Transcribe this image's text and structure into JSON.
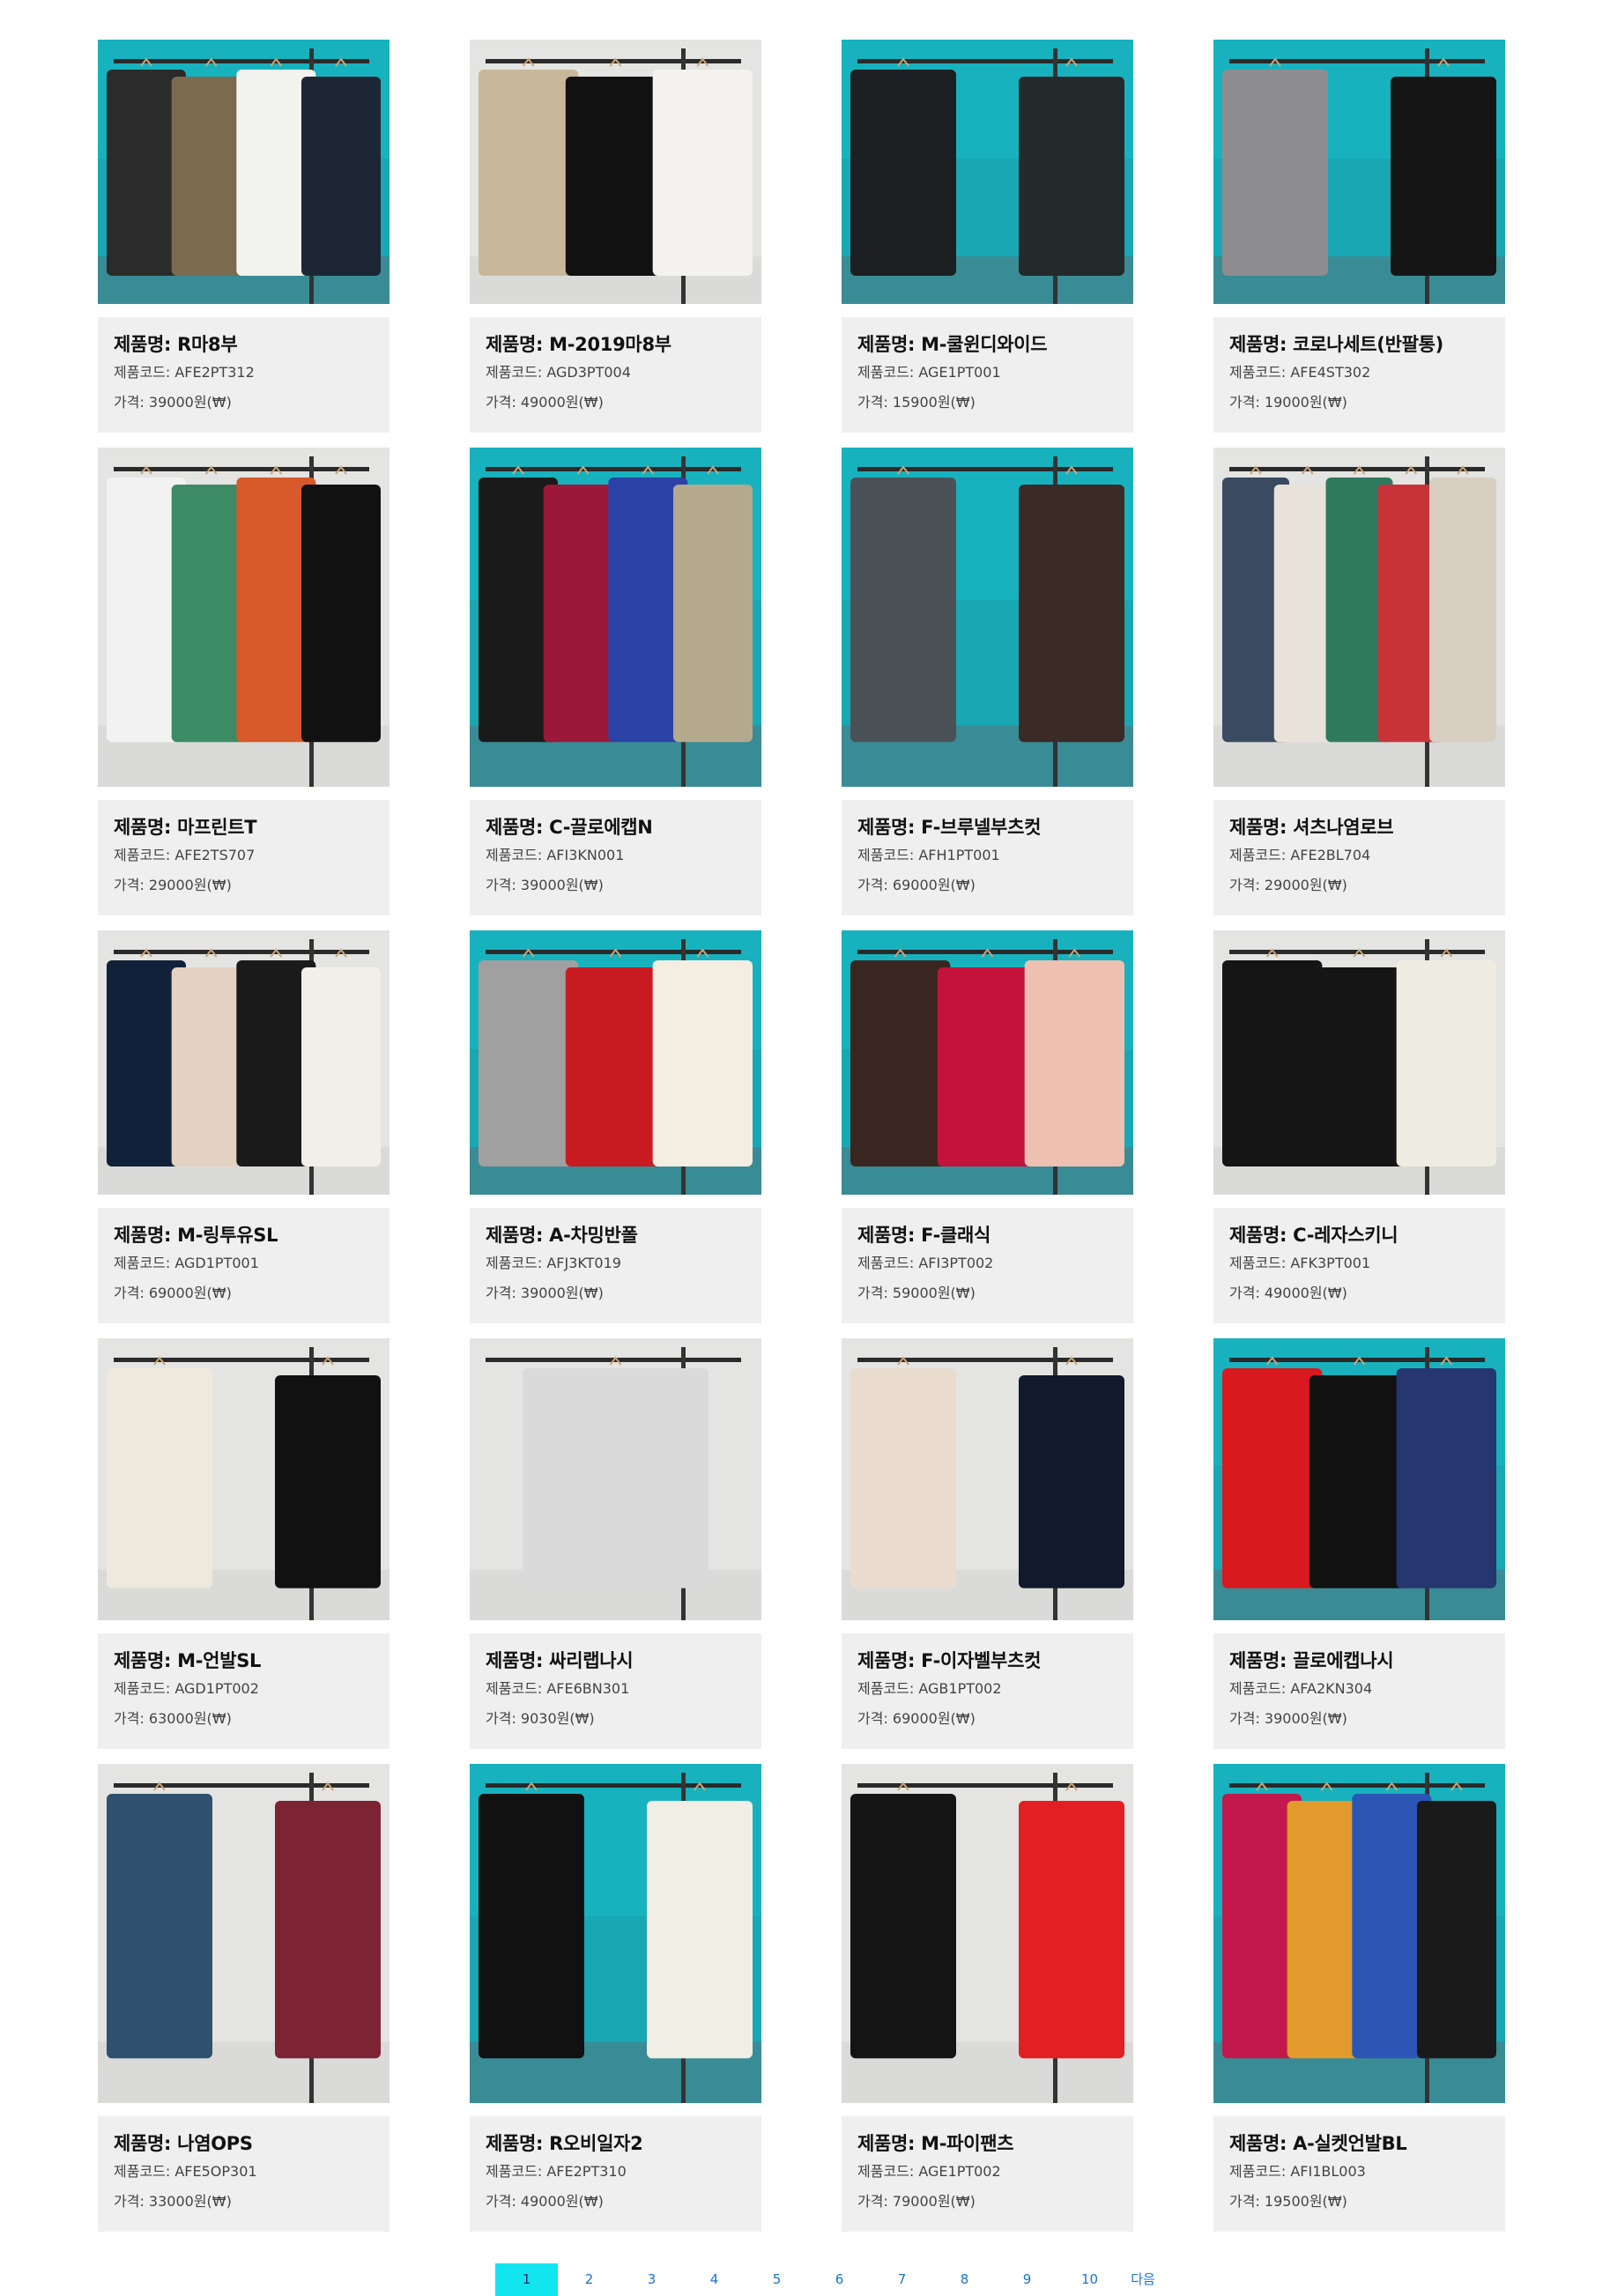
{
  "labels": {
    "name_prefix": "제품명: ",
    "code_prefix": "제품코드: ",
    "price_prefix": "가격: ",
    "currency_suffix": "원(₩)"
  },
  "products": [
    {
      "name": "R마8부",
      "code": "AFE2PT312",
      "price": "39000",
      "bg": "teal"
    },
    {
      "name": "M-2019마8부",
      "code": "AGD3PT004",
      "price": "49000",
      "bg": "white"
    },
    {
      "name": "M-쿨윈디와이드",
      "code": "AGE1PT001",
      "price": "15900",
      "bg": "teal"
    },
    {
      "name": "코로나세트(반팔통)",
      "code": "AFE4ST302",
      "price": "19000",
      "bg": "teal"
    },
    {
      "name": "마프린트T",
      "code": "AFE2TS707",
      "price": "29000",
      "bg": "white"
    },
    {
      "name": "C-끌로에캡N",
      "code": "AFI3KN001",
      "price": "39000",
      "bg": "teal"
    },
    {
      "name": "F-브루넬부츠컷",
      "code": "AFH1PT001",
      "price": "69000",
      "bg": "teal"
    },
    {
      "name": "셔츠나염로브",
      "code": "AFE2BL704",
      "price": "29000",
      "bg": "white"
    },
    {
      "name": "M-링투유SL",
      "code": "AGD1PT001",
      "price": "69000",
      "bg": "white"
    },
    {
      "name": "A-차밍반폴",
      "code": "AFJ3KT019",
      "price": "39000",
      "bg": "teal"
    },
    {
      "name": "F-클래식",
      "code": "AFI3PT002",
      "price": "59000",
      "bg": "teal"
    },
    {
      "name": "C-레자스키니",
      "code": "AFK3PT001",
      "price": "49000",
      "bg": "white"
    },
    {
      "name": "M-언발SL",
      "code": "AGD1PT002",
      "price": "63000",
      "bg": "white"
    },
    {
      "name": "싸리랩나시",
      "code": "AFE6BN301",
      "price": "9030",
      "bg": "white"
    },
    {
      "name": "F-이자벨부츠컷",
      "code": "AGB1PT002",
      "price": "69000",
      "bg": "white"
    },
    {
      "name": "끌로에캡나시",
      "code": "AFA2KN304",
      "price": "39000",
      "bg": "teal"
    },
    {
      "name": "나염OPS",
      "code": "AFE5OP301",
      "price": "33000",
      "bg": "white"
    },
    {
      "name": "R오비일자2",
      "code": "AFE2PT310",
      "price": "49000",
      "bg": "teal"
    },
    {
      "name": "M-파이팬츠",
      "code": "AGE1PT002",
      "price": "79000",
      "bg": "white"
    },
    {
      "name": "A-실켓언발BL",
      "code": "AFI1BL003",
      "price": "19500",
      "bg": "teal"
    }
  ],
  "row_photo_heights": [
    300,
    385,
    300,
    320,
    385
  ],
  "garment_colors": [
    [
      "#2b2b2b",
      "#7a6b4f",
      "#f2f2ee",
      "#1d2635"
    ],
    [
      "#c9b79a",
      "#111111",
      "#f3f2ee"
    ],
    [
      "#1c1f22",
      "#24292c"
    ],
    [
      "#8d8d8f",
      "#151515"
    ],
    [
      "#f2f2f2",
      "#3c8b64",
      "#d85a2a",
      "#111111"
    ],
    [
      "#1a1a1a",
      "#9b1838",
      "#2b43a8",
      "#b5a98d"
    ],
    [
      "#4a5258",
      "#3a2b27"
    ],
    [
      "#3a4a60",
      "#e8e3da",
      "#2f7a5f",
      "#c73339",
      "#d8cfc2"
    ],
    [
      "#12213a",
      "#e3d1c2",
      "#1a1a1a",
      "#f1efe8"
    ],
    [
      "#a0a0a0",
      "#c81c22",
      "#f3ede2"
    ],
    [
      "#3a2621",
      "#c3123c",
      "#edc0b2"
    ],
    [
      "#151515",
      "#151515",
      "#efece2"
    ],
    [
      "#efe9dd",
      "#111111"
    ],
    [
      "#dadada"
    ],
    [
      "#eadbcf",
      "#111a2c"
    ],
    [
      "#d8191f",
      "#111111",
      "#26366e"
    ],
    [
      "#30506f",
      "#7d2434"
    ],
    [
      "#111111",
      "#f1eee6"
    ],
    [
      "#141414",
      "#e41f23"
    ],
    [
      "#c2184e",
      "#e39a2c",
      "#2d55b6",
      "#1a1a1a"
    ]
  ],
  "pagination": {
    "pages": [
      "1",
      "2",
      "3",
      "4",
      "5",
      "6",
      "7",
      "8",
      "9",
      "10"
    ],
    "active": "1",
    "next_label": "다음"
  }
}
